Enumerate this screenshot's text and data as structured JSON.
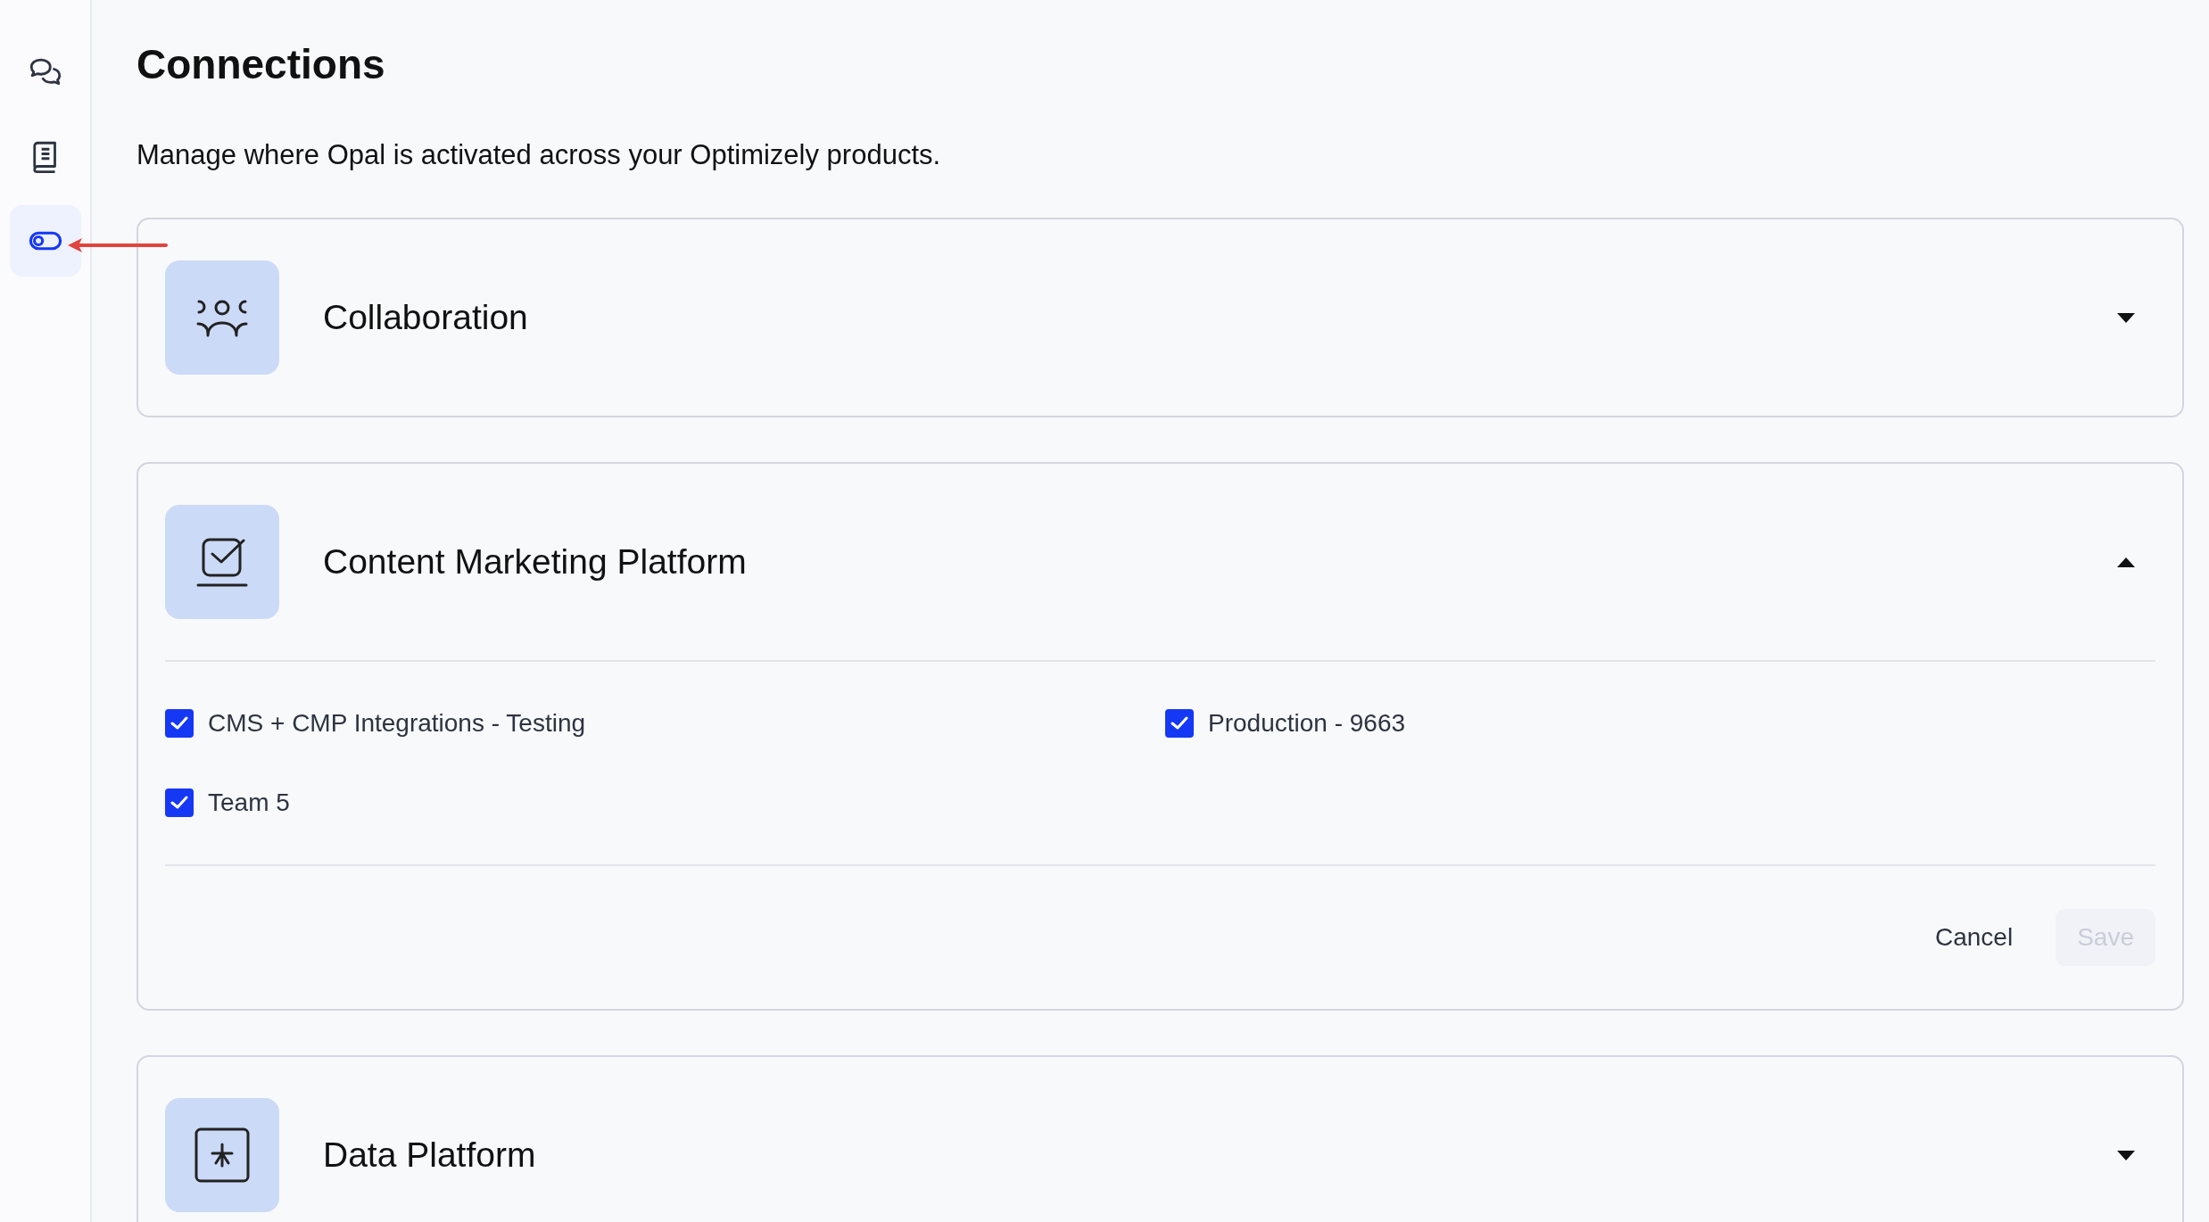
{
  "sidebar": {
    "items": [
      {
        "selected": false
      },
      {
        "selected": false
      },
      {
        "selected": true
      }
    ]
  },
  "page": {
    "title": "Connections",
    "subtitle": "Manage where Opal is activated across your Optimizely products."
  },
  "sections": [
    {
      "title": "Collaboration",
      "expanded": false
    },
    {
      "title": "Content Marketing Platform",
      "expanded": true,
      "options": [
        {
          "label": "CMS + CMP Integrations - Testing",
          "checked": true
        },
        {
          "label": "Production - 9663",
          "checked": true
        },
        {
          "label": "Team 5",
          "checked": true
        }
      ],
      "buttons": [
        {
          "label": "Cancel",
          "disabled": false
        },
        {
          "label": "Save",
          "disabled": true
        }
      ]
    },
    {
      "title": "Data Platform",
      "expanded": false
    }
  ]
}
